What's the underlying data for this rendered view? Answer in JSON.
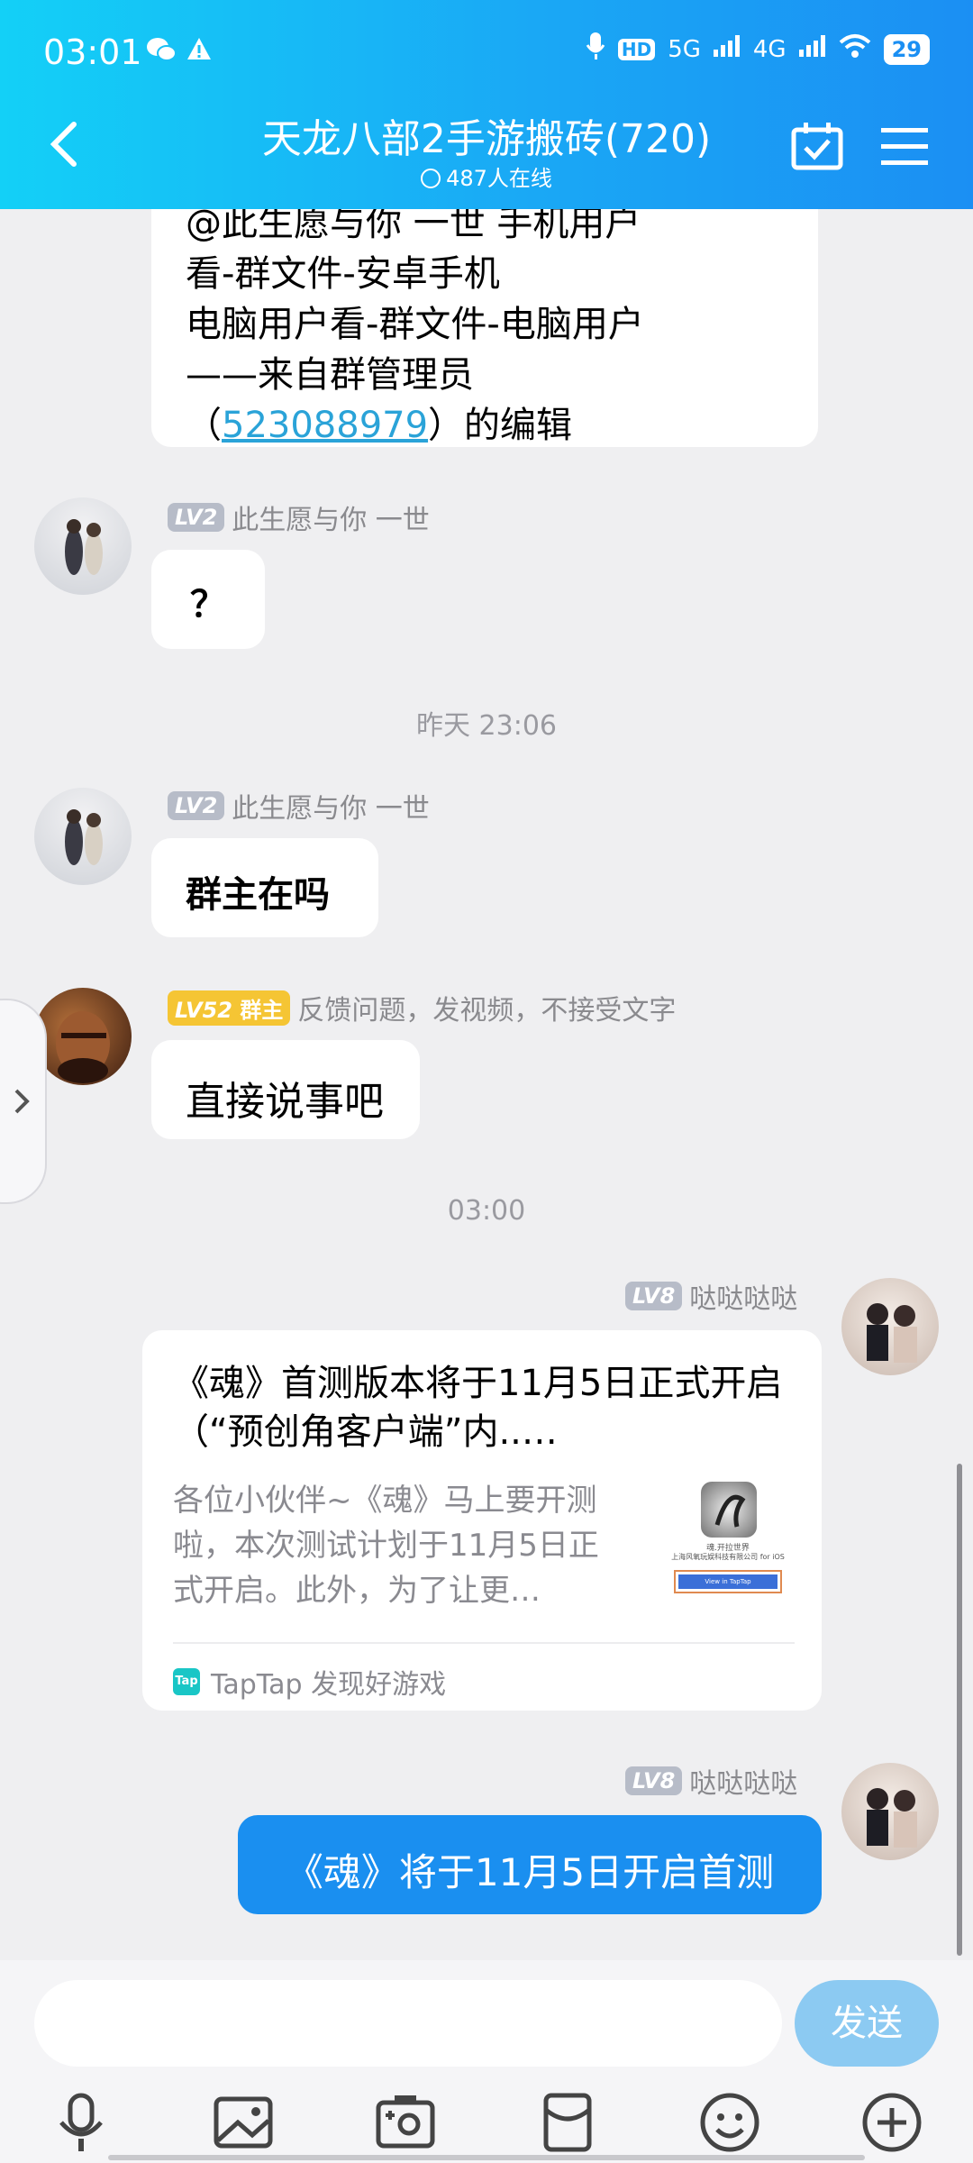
{
  "status_bar": {
    "time": "03:01",
    "network_1": "5G",
    "network_2": "4G",
    "battery": "29"
  },
  "header": {
    "title": "天龙八部2手游搬砖(720)",
    "online": "487人在线"
  },
  "messages": {
    "notice": {
      "line1": "@此生愿与你 一世 手机用户",
      "line2": "看-群文件-安卓手机",
      "line3": "电脑用户看-群文件-电脑用户",
      "line4": "——来自群管理员",
      "line5_prefix": "（",
      "line5_link": "523088979",
      "line5_suffix": "）的编辑"
    },
    "m1": {
      "level": "LV2",
      "name": "此生愿与你 一世",
      "text": "？"
    },
    "ts1": "昨天 23:06",
    "m2": {
      "level": "LV2",
      "name": "此生愿与你 一世",
      "text": "群主在吗"
    },
    "m3": {
      "level": "LV52",
      "role": "群主",
      "name": "反馈问题，发视频，不接受文字",
      "text": "直接说事吧"
    },
    "ts2": "03:00",
    "m4": {
      "level": "LV8",
      "name": "哒哒哒哒",
      "card_title": "《魂》首测版本将于11月5日正式开启（“预创角客户端”内..…",
      "card_desc": "各位小伙伴~《魂》马上要开测啦，本次测试计划于11月5日正式开启。此外，为了让更…",
      "thumb_caption_1": "魂.开拉世界",
      "thumb_caption_2": "上海风氧玩娱科技有限公司 for iOS",
      "thumb_button": "View in TapTap",
      "source_icon": "Tap",
      "source": "TapTap 发现好游戏"
    },
    "m5": {
      "level": "LV8",
      "name": "哒哒哒哒",
      "text": "《魂》将于11月5日开启首测"
    }
  },
  "input_bar": {
    "placeholder": "",
    "send_label": "发送"
  },
  "colors": {
    "accent": "#1b8ff3",
    "self_bubble": "#1a8ff0",
    "owner_badge": "#f5c534"
  }
}
